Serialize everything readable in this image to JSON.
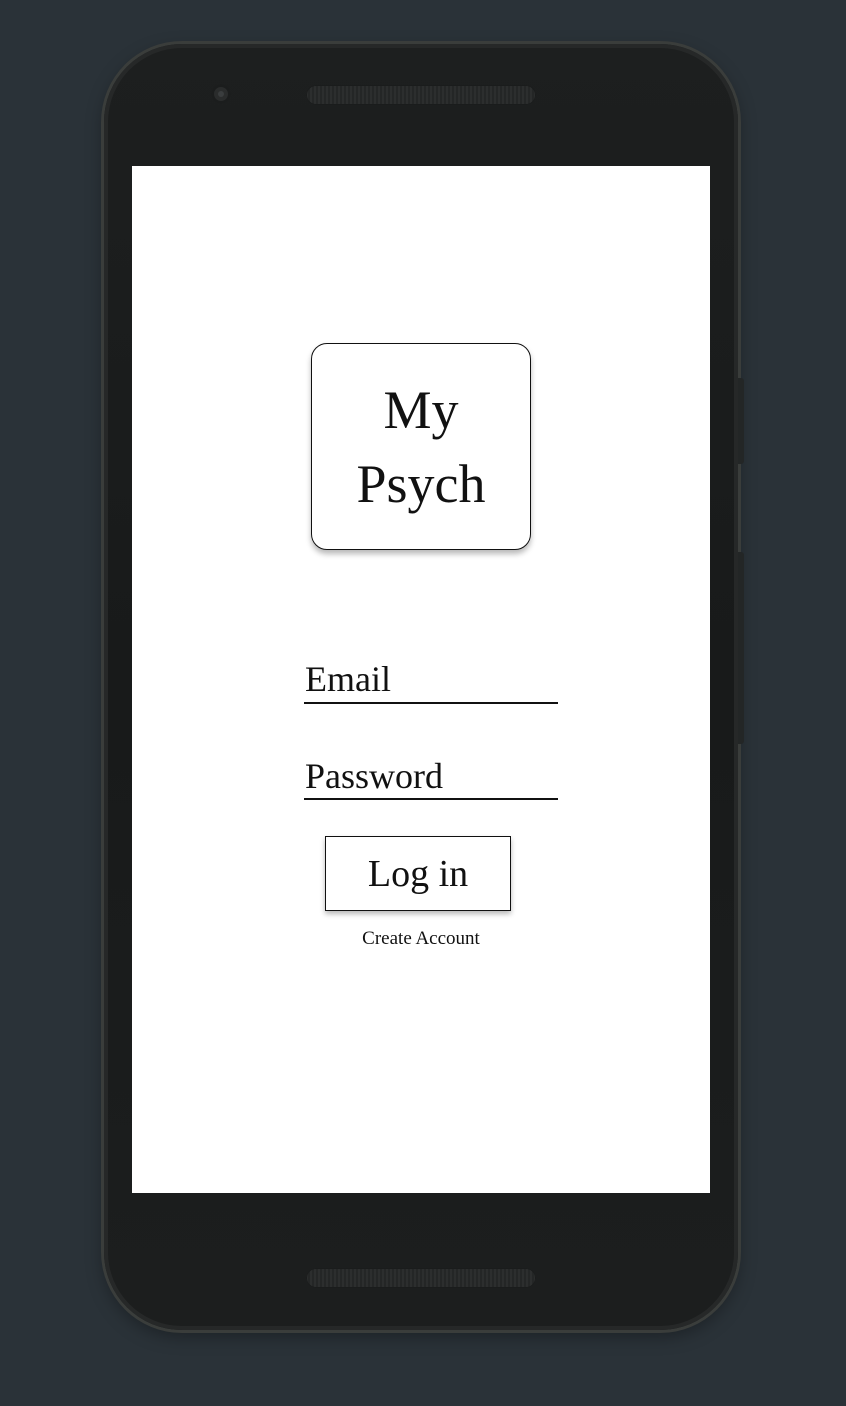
{
  "logo": {
    "line1": "My",
    "line2": "Psych"
  },
  "form": {
    "email_placeholder": "Email",
    "password_placeholder": "Password",
    "login_label": "Log in",
    "create_account_label": "Create Account"
  },
  "colors": {
    "background": "#2a3238",
    "phone_body": "#1b1d1d",
    "screen": "#ffffff",
    "ink": "#111111"
  }
}
